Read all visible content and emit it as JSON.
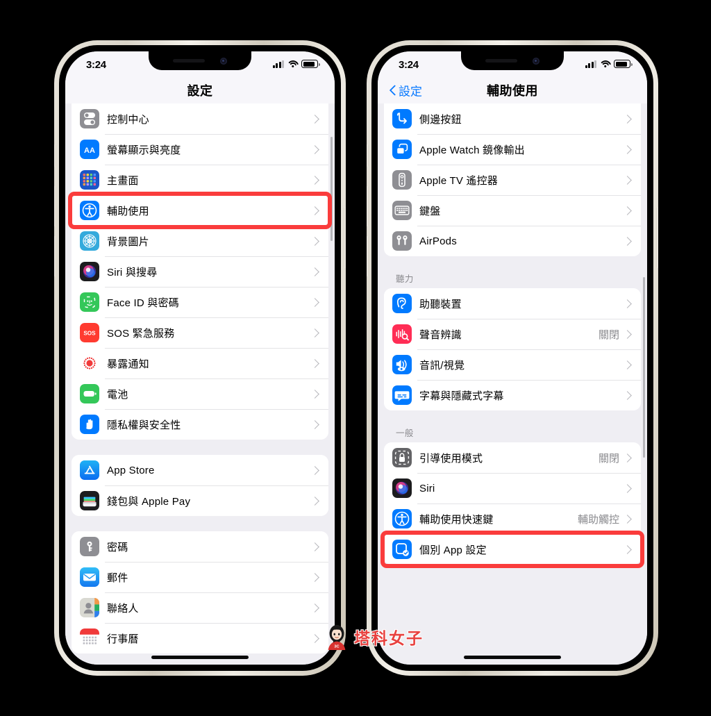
{
  "meta": {
    "background_color": "#000000",
    "accent_blue": "#0A7AFF",
    "highlight_red": "#FA3C3C",
    "screen_bg": "#EFEEF3"
  },
  "watermark": {
    "text": "塔科女子",
    "badge": "3C",
    "color": "#E8413F"
  },
  "left_phone": {
    "status": {
      "time": "3:24",
      "signal": "signal-icon",
      "wifi": "wifi-icon",
      "battery": "battery-icon"
    },
    "nav": {
      "title": "設定"
    },
    "groups": [
      {
        "label": "",
        "rows": [
          {
            "label": "控制中心",
            "icon": "control-center-icon",
            "icon_bg": "#8E8E93",
            "value": "",
            "highlighted": false
          },
          {
            "label": "螢幕顯示與亮度",
            "icon": "display-brightness-icon",
            "icon_bg": "#007AFF",
            "value": "",
            "highlighted": false
          },
          {
            "label": "主畫面",
            "icon": "home-screen-icon",
            "icon_bg": "#1B55C8",
            "value": "",
            "highlighted": false
          },
          {
            "label": "輔助使用",
            "icon": "accessibility-icon",
            "icon_bg": "#007AFF",
            "value": "",
            "highlighted": true
          },
          {
            "label": "背景圖片",
            "icon": "wallpaper-icon",
            "icon_bg": "#34AADC",
            "value": "",
            "highlighted": false
          },
          {
            "label": "Siri 與搜尋",
            "icon": "siri-icon",
            "icon_bg": "#1C1C1E",
            "value": "",
            "highlighted": false
          },
          {
            "label": "Face ID 與密碼",
            "icon": "faceid-icon",
            "icon_bg": "#34C759",
            "value": "",
            "highlighted": false
          },
          {
            "label": "SOS 緊急服務",
            "icon": "sos-icon",
            "icon_bg": "#FF3B30",
            "value": "",
            "highlighted": false
          },
          {
            "label": "暴露通知",
            "icon": "exposure-notification-icon",
            "icon_bg": "#FFFFFF",
            "value": "",
            "highlighted": false
          },
          {
            "label": "電池",
            "icon": "battery-settings-icon",
            "icon_bg": "#34C759",
            "value": "",
            "highlighted": false
          },
          {
            "label": "隱私權與安全性",
            "icon": "privacy-hand-icon",
            "icon_bg": "#007AFF",
            "value": "",
            "highlighted": false
          }
        ]
      },
      {
        "label": "",
        "rows": [
          {
            "label": "App Store",
            "icon": "app-store-icon",
            "icon_bg": "#1D8FF5",
            "value": "",
            "highlighted": false
          },
          {
            "label": "錢包與 Apple Pay",
            "icon": "wallet-icon",
            "icon_bg": "#1C1C1E",
            "value": "",
            "highlighted": false
          }
        ]
      },
      {
        "label": "",
        "rows": [
          {
            "label": "密碼",
            "icon": "passwords-key-icon",
            "icon_bg": "#8E8E93",
            "value": "",
            "highlighted": false
          },
          {
            "label": "郵件",
            "icon": "mail-icon",
            "icon_bg": "#1D9BF0",
            "value": "",
            "highlighted": false
          },
          {
            "label": "聯絡人",
            "icon": "contacts-icon",
            "icon_bg": "#D8D8D2",
            "value": "",
            "highlighted": false
          },
          {
            "label": "行事曆",
            "icon": "calendar-icon",
            "icon_bg": "#FFFFFF",
            "value": "",
            "highlighted": false
          }
        ]
      }
    ]
  },
  "right_phone": {
    "status": {
      "time": "3:24",
      "signal": "signal-icon",
      "wifi": "wifi-icon",
      "battery": "battery-icon"
    },
    "nav": {
      "back_label": "設定",
      "title": "輔助使用"
    },
    "groups": [
      {
        "label": "",
        "rows": [
          {
            "label": "側邊按鈕",
            "icon": "side-button-icon",
            "icon_bg": "#007AFF",
            "value": "",
            "highlighted": false
          },
          {
            "label": "Apple Watch 鏡像輸出",
            "icon": "watch-mirroring-icon",
            "icon_bg": "#007AFF",
            "value": "",
            "highlighted": false
          },
          {
            "label": "Apple TV 遙控器",
            "icon": "apple-tv-remote-icon",
            "icon_bg": "#8E8E93",
            "value": "",
            "highlighted": false
          },
          {
            "label": "鍵盤",
            "icon": "keyboard-icon",
            "icon_bg": "#8E8E93",
            "value": "",
            "highlighted": false
          },
          {
            "label": "AirPods",
            "icon": "airpods-icon",
            "icon_bg": "#8E8E93",
            "value": "",
            "highlighted": false
          }
        ]
      },
      {
        "label": "聽力",
        "rows": [
          {
            "label": "助聽裝置",
            "icon": "hearing-devices-icon",
            "icon_bg": "#007AFF",
            "value": "",
            "highlighted": false
          },
          {
            "label": "聲音辨識",
            "icon": "sound-recognition-icon",
            "icon_bg": "#FF2D55",
            "value": "關閉",
            "highlighted": false
          },
          {
            "label": "音訊/視覺",
            "icon": "audio-visual-icon",
            "icon_bg": "#007AFF",
            "value": "",
            "highlighted": false
          },
          {
            "label": "字幕與隱藏式字幕",
            "icon": "subtitles-icon",
            "icon_bg": "#007AFF",
            "value": "",
            "highlighted": false
          }
        ]
      },
      {
        "label": "一般",
        "rows": [
          {
            "label": "引導使用模式",
            "icon": "guided-access-icon",
            "icon_bg": "#636366",
            "value": "關閉",
            "highlighted": false
          },
          {
            "label": "Siri",
            "icon": "siri-icon",
            "icon_bg": "#1C1C1E",
            "value": "",
            "highlighted": false
          },
          {
            "label": "輔助使用快速鍵",
            "icon": "accessibility-icon",
            "icon_bg": "#007AFF",
            "value": "輔助觸控",
            "highlighted": false
          },
          {
            "label": "個別 App 設定",
            "icon": "per-app-settings-icon",
            "icon_bg": "#007AFF",
            "value": "",
            "highlighted": true
          }
        ]
      }
    ]
  }
}
